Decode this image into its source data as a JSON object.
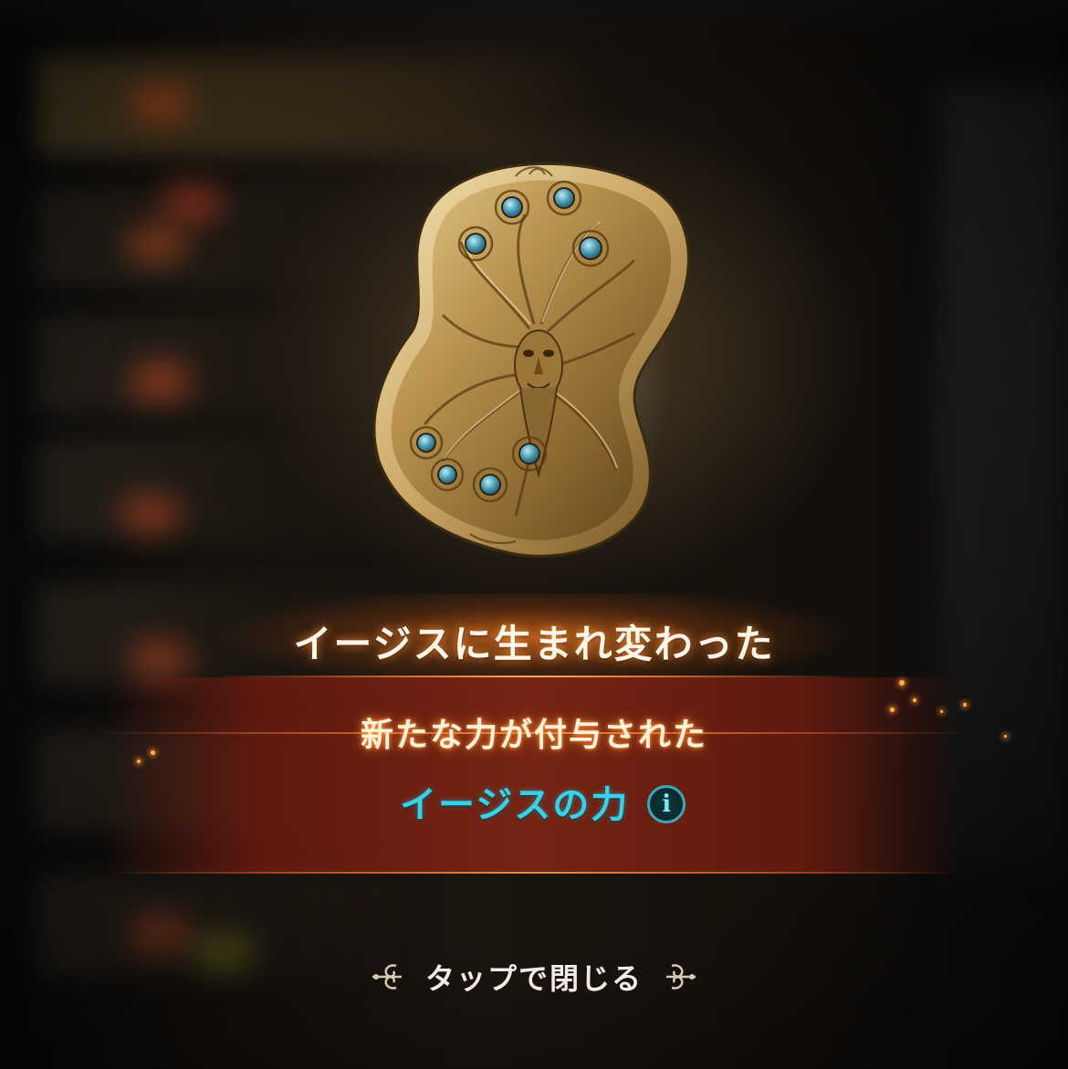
{
  "result": {
    "title": "イージスに生まれ変わった",
    "subtitle": "新たな力が付与された",
    "power_name": "イージスの力",
    "info_symbol": "i"
  },
  "close_prompt": "タップで閉じる",
  "colors": {
    "title_glow": "#e66e19",
    "power_text": "#35d2e8",
    "band": "#8c2814"
  },
  "icons": [
    "aegis-shield-icon",
    "info-icon",
    "ornament-left-icon",
    "ornament-right-icon"
  ]
}
